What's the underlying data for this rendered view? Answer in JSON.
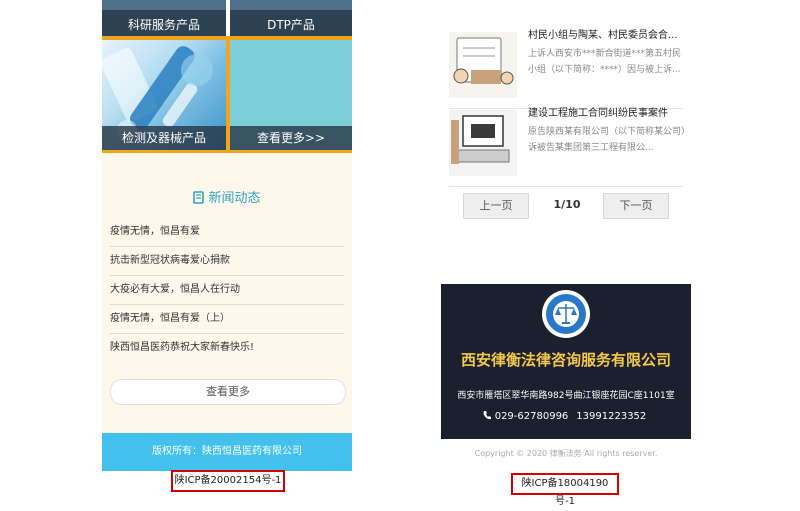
{
  "left": {
    "tiles": {
      "research": "科研服务产品",
      "dtp": "DTP产品",
      "lab": "检测及器械产品",
      "more": "查看更多>>"
    },
    "news": {
      "heading": "新闻动态",
      "items": [
        "疫情无情，恒昌有爱",
        "抗击新型冠状病毒爱心捐款",
        "大疫必有大爱，恒昌人在行动",
        "疫情无情，恒昌有爱（上）",
        "陕西恒昌医药恭祝大家新春快乐!"
      ],
      "more_label": "查看更多"
    },
    "footer": "版权所有：陕西恒昌医药有限公司",
    "icp": "陕ICP备20002154号-1"
  },
  "right": {
    "cases": [
      {
        "title": "村民小组与陶某、村民委员会合...",
        "desc": "上诉人西安市***新合街道***第五村民小组（以下简称：****）因与被上诉..."
      },
      {
        "title": "建设工程施工合同纠纷民事案件",
        "desc": "原告陕西某有限公司（以下简称某公司）诉被告某集团第三工程有限公..."
      }
    ],
    "pagination": {
      "prev": "上一页",
      "current": "1/10",
      "next": "下一页"
    },
    "firm": {
      "name": "西安律衡法律咨询服务有限公司",
      "address": "西安市雁塔区翠华南路982号曲江银座花园C座1101室",
      "phone1": "029-62780996",
      "phone2": "13991223352"
    },
    "copyright": "Copyright © 2020 律衡法务 All rights reserver.",
    "icp": "陕ICP备18004190号-1"
  }
}
